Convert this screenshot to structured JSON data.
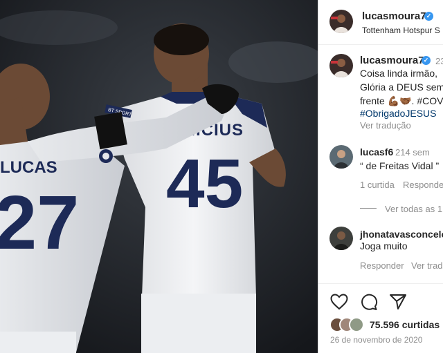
{
  "post": {
    "author": "lucasmoura7",
    "location": "Tottenham Hotspur S",
    "time_ago": "23",
    "caption_lines": [
      "Coisa linda irmão,",
      "Glória a DEUS sem",
      "frente 💪🏾🤝🏾. #COV",
      "#ObrigadoJESUS"
    ],
    "see_translation": "Ver tradução"
  },
  "comments": [
    {
      "user": "lucasf6",
      "time": "214 sem",
      "text": "“ de Freitas Vidal ”",
      "likes": "1 curtida",
      "reply": "Responder",
      "view_replies": "Ver todas as 1"
    },
    {
      "user": "jhonatavasconcelo",
      "text": "Joga muito",
      "reply": "Responder",
      "see_translation": "Ver tradu"
    }
  ],
  "footer": {
    "likes": "75.596 curtidas",
    "date": "26 de novembro de 2020"
  },
  "jerseys": {
    "left_name": "LUCAS",
    "left_number": "27",
    "right_name": "VINICIUS",
    "right_number": "45",
    "sleeve_badge": "BT SPORT"
  },
  "colors": {
    "verified": "#3897f0",
    "hashtag": "#00376b",
    "jersey_navy": "#1d2a57"
  },
  "icons": [
    "verified-icon",
    "heart-icon",
    "comment-icon",
    "share-icon"
  ]
}
